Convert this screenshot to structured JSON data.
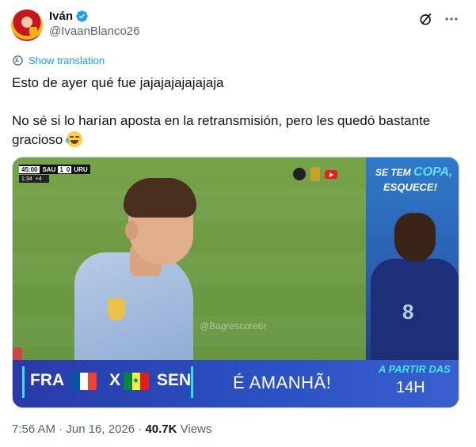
{
  "author": {
    "display_name": "Iván",
    "handle": "@IvaanBlanco26"
  },
  "translate_label": "Show translation",
  "tweet_text": "Esto de ayer qué fue jajajajajajajaja\n\nNo sé si lo harían aposta en la retransmisión, pero les quedó bastante\ngracioso ",
  "media": {
    "scorebug": {
      "clock": "45:00",
      "team_home": "SAU",
      "score_home": "1",
      "score_away": "0",
      "team_away": "URU",
      "added_time": "1:34",
      "added_extra": "+4"
    },
    "watermark": "@Bagrescore6r",
    "promo": {
      "line1_a": "SE TEM ",
      "line1_b": "COPA,",
      "line2": "ESQUECE!",
      "shirt_number": "8"
    },
    "banner": {
      "team1": "FRA",
      "vs": "X",
      "team2": "SEN",
      "headline": "É AMANHÃ!",
      "from_label": "A PARTIR DAS",
      "time": "14H"
    }
  },
  "meta": {
    "timestamp": "7:56 AM · Jun 16, 2026 · ",
    "views_count": "40.7K",
    "views_label": " Views"
  },
  "colors": {
    "link": "#1d9bf0",
    "verified": "#1d9bf0",
    "banner_accent": "#2ee6e8"
  }
}
